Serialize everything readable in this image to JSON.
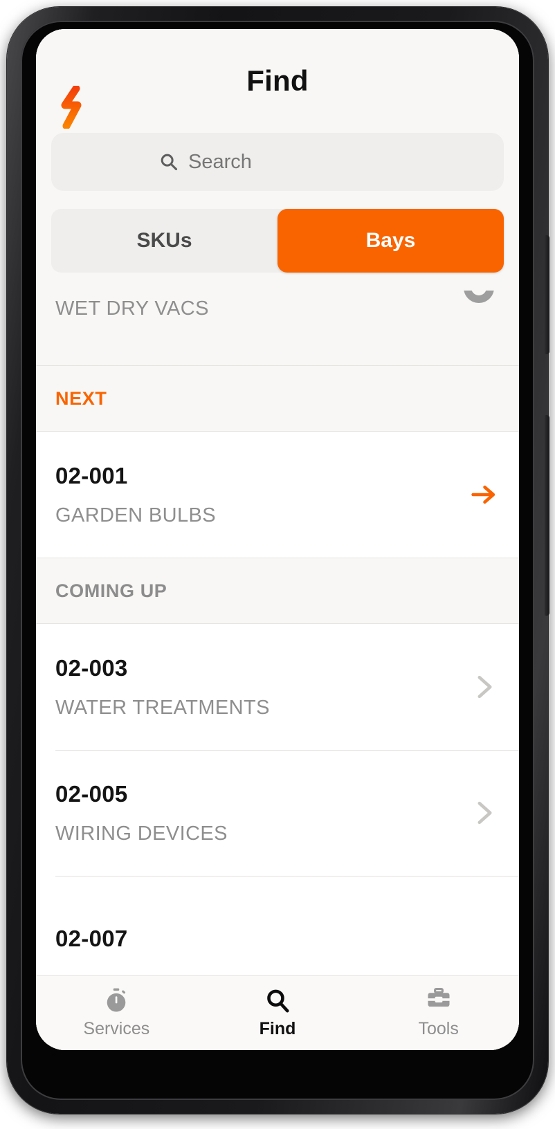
{
  "device": {
    "camera_icon": "front-camera-punch-hole",
    "volume_button": "volume-rocker",
    "power_button": "power-button"
  },
  "header": {
    "logo_icon": "lightning-bolt-logo",
    "title": "Find",
    "accent_color": "#f96400"
  },
  "search": {
    "icon": "search-icon",
    "placeholder": "Search",
    "value": ""
  },
  "segmented_control": {
    "tabs": [
      {
        "label": "SKUs",
        "active": false
      },
      {
        "label": "Bays",
        "active": true
      }
    ]
  },
  "list": {
    "scrolled_row": {
      "name": "WET DRY VACS",
      "status_icon": "check-circle-icon"
    },
    "sections": [
      {
        "header": "NEXT",
        "header_color": "#f96400",
        "rows": [
          {
            "code": "02-001",
            "name": "GARDEN BULBS",
            "affordance": "arrow-right-icon",
            "affordance_color": "#f96400"
          }
        ]
      },
      {
        "header": "COMING UP",
        "header_color": "#8c8c8c",
        "rows": [
          {
            "code": "02-003",
            "name": "WATER TREATMENTS",
            "affordance": "chevron-right-icon",
            "affordance_color": "#c9c7c4"
          },
          {
            "code": "02-005",
            "name": "WIRING DEVICES",
            "affordance": "chevron-right-icon",
            "affordance_color": "#c9c7c4"
          },
          {
            "code": "02-007",
            "name": "",
            "affordance": "chevron-right-icon",
            "affordance_color": "#c9c7c4"
          }
        ]
      }
    ]
  },
  "bottom_nav": {
    "items": [
      {
        "label": "Services",
        "icon": "stopwatch-icon",
        "active": false
      },
      {
        "label": "Find",
        "icon": "search-icon",
        "active": true
      },
      {
        "label": "Tools",
        "icon": "toolbox-icon",
        "active": false
      }
    ]
  }
}
